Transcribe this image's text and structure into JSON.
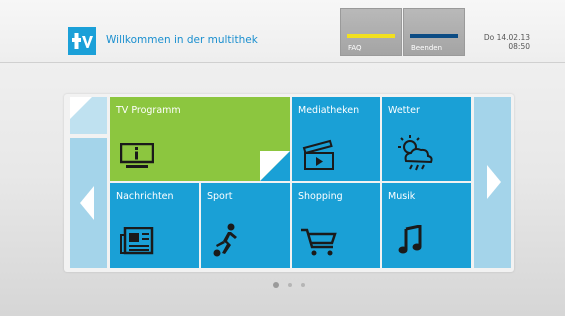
{
  "header": {
    "logo_icon": "tv-logo-icon",
    "welcome_text": "Willkommen in der multithek",
    "faq_label": "FAQ",
    "faq_color": "#f2e01e",
    "beenden_label": "Beenden",
    "beenden_color": "#0c4c84",
    "date": "Do 14.02.13",
    "time": "08:50"
  },
  "grid": {
    "tiles": [
      {
        "label": "TV Programm",
        "icon": "tv-screen-icon",
        "color": "#8cc63f"
      },
      {
        "label": "Mediatheken",
        "icon": "clapperboard-icon",
        "color": "#1aa0d6"
      },
      {
        "label": "Wetter",
        "icon": "weather-cloud-sun-icon",
        "color": "#1aa0d6"
      },
      {
        "label": "Nachrichten",
        "icon": "newspaper-icon",
        "color": "#1aa0d6"
      },
      {
        "label": "Sport",
        "icon": "football-player-icon",
        "color": "#1aa0d6"
      },
      {
        "label": "Shopping",
        "icon": "shopping-cart-icon",
        "color": "#1aa0d6"
      },
      {
        "label": "Musik",
        "icon": "music-note-icon",
        "color": "#1aa0d6"
      }
    ]
  },
  "pagination": {
    "pages": 3,
    "current": 1
  }
}
